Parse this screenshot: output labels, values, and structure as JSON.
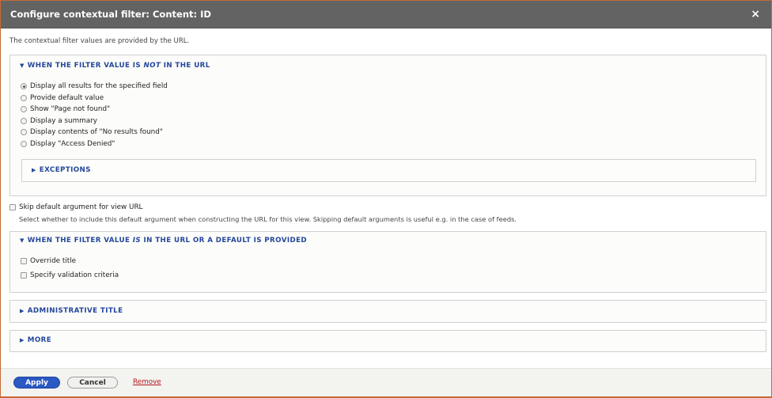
{
  "dialog": {
    "title": "Configure contextual filter: Content: ID",
    "close_glyph": "×"
  },
  "description": "The contextual filter values are provided by the URL.",
  "not_in_url": {
    "legend_pre": "WHEN THE FILTER VALUE IS ",
    "legend_em": "NOT",
    "legend_post": " IN THE URL",
    "options": [
      {
        "label": "Display all results for the specified field",
        "checked": true
      },
      {
        "label": "Provide default value",
        "checked": false
      },
      {
        "label": "Show \"Page not found\"",
        "checked": false
      },
      {
        "label": "Display a summary",
        "checked": false
      },
      {
        "label": "Display contents of \"No results found\"",
        "checked": false
      },
      {
        "label": "Display \"Access Denied\"",
        "checked": false
      }
    ],
    "exceptions_label": "EXCEPTIONS"
  },
  "skip_default": {
    "label": "Skip default argument for view URL",
    "description": "Select whether to include this default argument when constructing the URL for this view. Skipping default arguments is useful e.g. in the case of feeds."
  },
  "in_url": {
    "legend_pre": "WHEN THE FILTER VALUE ",
    "legend_em": "IS",
    "legend_post": " IN THE URL OR A DEFAULT IS PROVIDED",
    "options": [
      {
        "label": "Override title"
      },
      {
        "label": "Specify validation criteria"
      }
    ]
  },
  "administrative_title": "ADMINISTRATIVE TITLE",
  "more": "MORE",
  "footer": {
    "apply": "Apply",
    "cancel": "Cancel",
    "remove": "Remove"
  },
  "colors": {
    "titlebar": "#636363",
    "link_blue": "#24479c",
    "apply_button": "#2b59c3",
    "remove_link": "#b4151b",
    "backdrop": "#c46a37"
  },
  "icons": {
    "expanded": "triangle-down-icon",
    "collapsed": "triangle-right-icon",
    "close": "close-icon"
  }
}
